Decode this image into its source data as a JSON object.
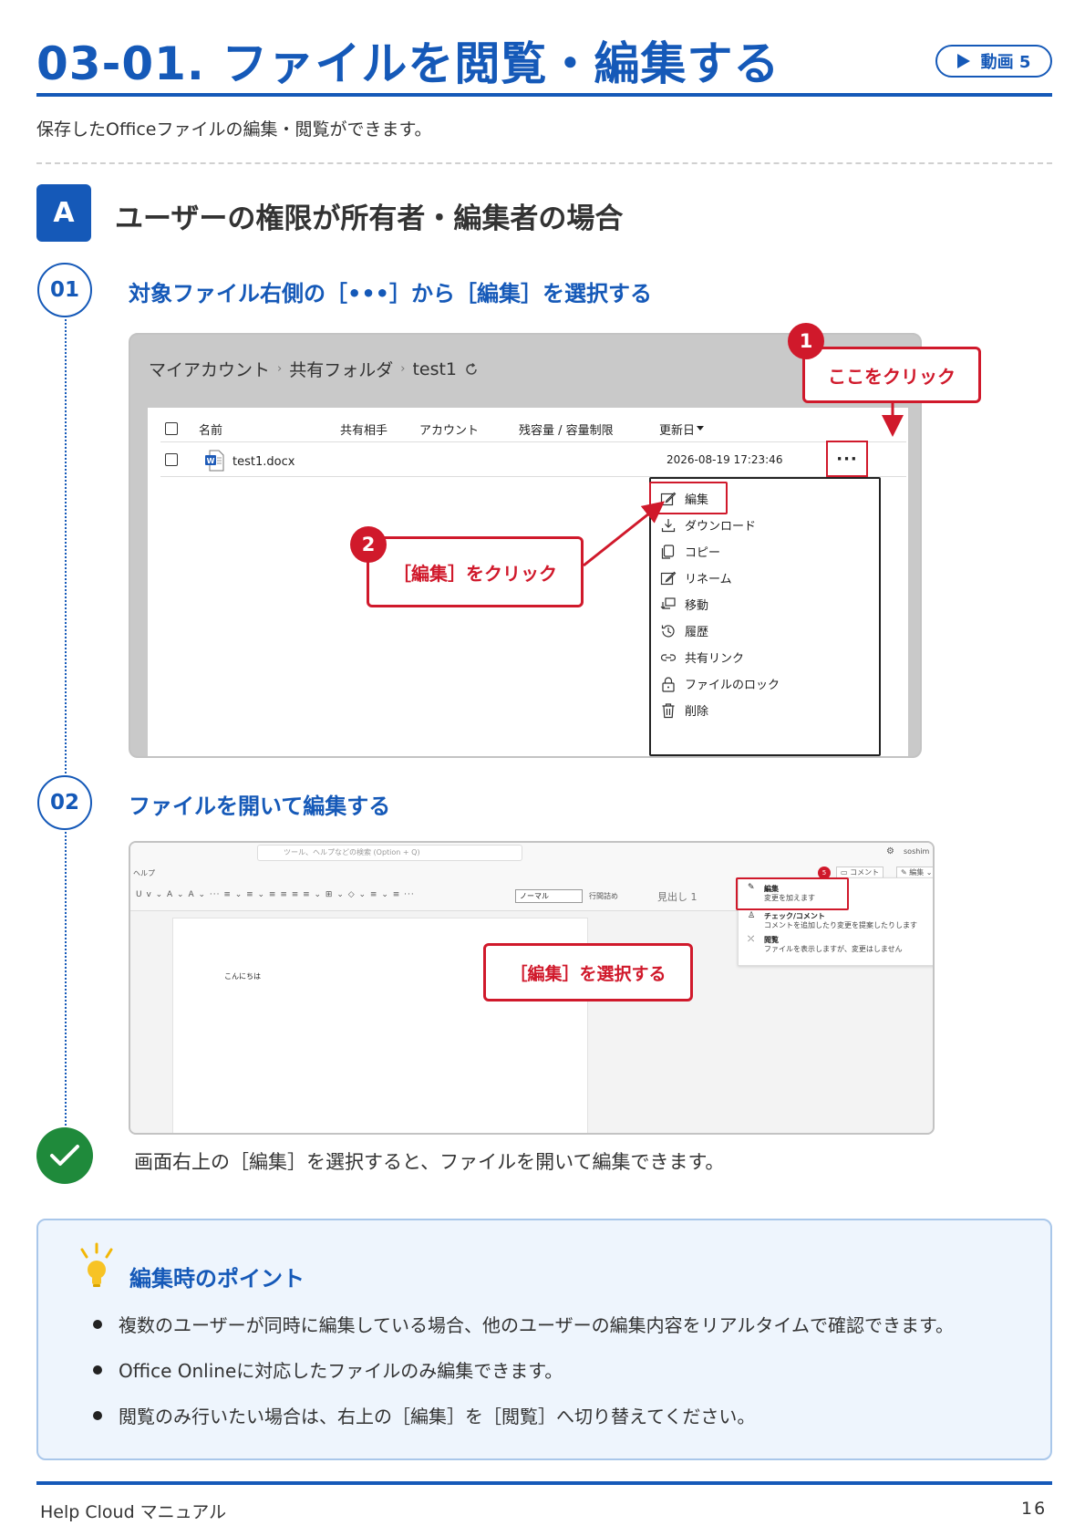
{
  "header": {
    "title": "03-01. ファイルを閲覧・編集する",
    "video_label": "動画 5",
    "intro": "保存したOfficeファイルの編集・閲覧ができます。"
  },
  "section": {
    "badge": "A",
    "title": "ユーザーの権限が所有者・編集者の場合"
  },
  "steps": [
    {
      "number": "01",
      "title": "対象ファイル右側の［•••］から［編集］を選択する"
    },
    {
      "number": "02",
      "title": "ファイルを開いて編集する"
    }
  ],
  "screenshot1": {
    "breadcrumb": [
      "マイアカウント",
      "共有フォルダ",
      "test1"
    ],
    "columns": [
      "名前",
      "共有相手",
      "アカウント",
      "残容量 / 容量制限",
      "更新日"
    ],
    "file": {
      "name": "test1.docx",
      "updated": "2026-08-19 17:23:46"
    },
    "more_label": "···",
    "menu_items": [
      {
        "icon": "pencil-square-icon",
        "label": "編集"
      },
      {
        "icon": "download-icon",
        "label": "ダウンロード"
      },
      {
        "icon": "copy-icon",
        "label": "コピー"
      },
      {
        "icon": "rename-icon",
        "label": "リネーム"
      },
      {
        "icon": "move-icon",
        "label": "移動"
      },
      {
        "icon": "history-icon",
        "label": "履歴"
      },
      {
        "icon": "link-icon",
        "label": "共有リンク"
      },
      {
        "icon": "lock-icon",
        "label": "ファイルのロック"
      },
      {
        "icon": "trash-icon",
        "label": "削除"
      }
    ],
    "callout1": {
      "number": "1",
      "text": "ここをクリック"
    },
    "callout2": {
      "number": "2",
      "text": "［編集］をクリック"
    }
  },
  "screenshot2": {
    "search_placeholder": "ツール、ヘルプなどの検索 (Option + Q)",
    "user": "soshim",
    "help_label": "ヘルプ",
    "toolbar_text": "U  ⅴ ⌄  A ⌄  A ⌄  ···  ≡ ⌄  ≡ ⌄  ≡  ≡  ≡  ≡ ⌄  ⊞ ⌄  ◇ ⌄  ≡ ⌄  ≡  ···",
    "style_box": "ノーマル",
    "line_spacing": "行間詰め",
    "heading": "見出し 1",
    "comment_btn": "コメント",
    "edit_btn": "編集",
    "badge_count": "5",
    "doc_text": "こんにちは",
    "options": [
      {
        "title": "編集",
        "desc": "変更を加えます"
      },
      {
        "title": "チェック/コメント",
        "desc": "コメントを追加したり変更を提案したりします"
      },
      {
        "title": "閲覧",
        "desc": "ファイルを表示しますが、変更はしません"
      }
    ],
    "callout": "［編集］を選択する"
  },
  "result_text": "画面右上の［編集］を選択すると、ファイルを開いて編集できます。",
  "tips": {
    "title": "編集時のポイント",
    "items": [
      "複数のユーザーが同時に編集している場合、他のユーザーの編集内容をリアルタイムで確認できます。",
      "Office Onlineに対応したファイルのみ編集できます。",
      "閲覧のみ行いたい場合は、右上の［編集］を［閲覧］へ切り替えてください。"
    ]
  },
  "footer": {
    "left": "Help Cloud マニュアル",
    "page": "16"
  },
  "colors": {
    "primary": "#1559b8",
    "accent_red": "#d0192b",
    "success": "#1f8a3b",
    "tip_bg": "#eef5fd"
  }
}
